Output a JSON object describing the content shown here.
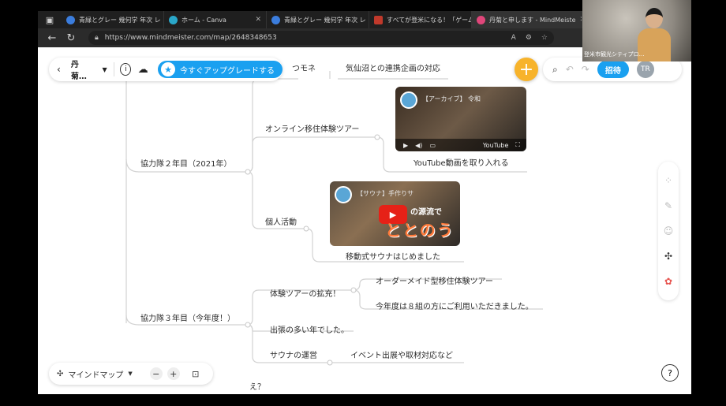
{
  "browser": {
    "tabs": [
      {
        "label": "青緑とグレー 幾何学 年次 レ",
        "color": "#3b7ddd"
      },
      {
        "label": "ホーム - Canva",
        "color": "#2aa7c9"
      },
      {
        "label": "青緑とグレー 幾何学 年次 レ",
        "color": "#3b7ddd"
      },
      {
        "label": "すべてが登米になる！「ゲーム",
        "color": "#c0392b"
      },
      {
        "label": "丹菊と申します - MindMeiste",
        "color": "#e0467a"
      }
    ],
    "url": "https://www.mindmeister.com/map/2648348653"
  },
  "toolbar": {
    "map_title": "丹菊…",
    "upgrade_label": "今すぐアップグレードする",
    "invite_label": "招待",
    "avatar_initials": "TR"
  },
  "mindmap": {
    "nodes": {
      "top_partial": "つモネ",
      "top_right": "気仙沼との連携企画の対応",
      "year2": "協力隊２年目（2021年）",
      "online_tour": "オンライン移住体験ツアー",
      "youtube_caption": "YouTube動画を取り入れる",
      "personal": "個人活動",
      "sauna_caption": "移動式サウナはじめました",
      "year3": "協力隊３年目（今年度！）",
      "tour_expand": "体験ツアーの拡充！",
      "ordermade": "オーダーメイド型移住体験ツアー",
      "eight_groups": "今年度は８組の方にご利用いただきました。",
      "business_trips": "出張の多い年でした。",
      "sauna_ops": "サウナの運営",
      "events": "イベント出展や取材対応など"
    },
    "video1": {
      "title": "【アーカイブ】 令和",
      "brand": "YouTube"
    },
    "video2": {
      "title": "【サウナ】手作りサ",
      "overlay_mid": "の源流で",
      "overlay_big": "ととのう"
    }
  },
  "bottom": {
    "view_label": "マインドマップ",
    "partial_text": "え？"
  },
  "webcam": {
    "caption": "登米市観光シティプロ…"
  },
  "colors": {
    "accent": "#1aa0f0",
    "add_button": "#f7b32b"
  }
}
